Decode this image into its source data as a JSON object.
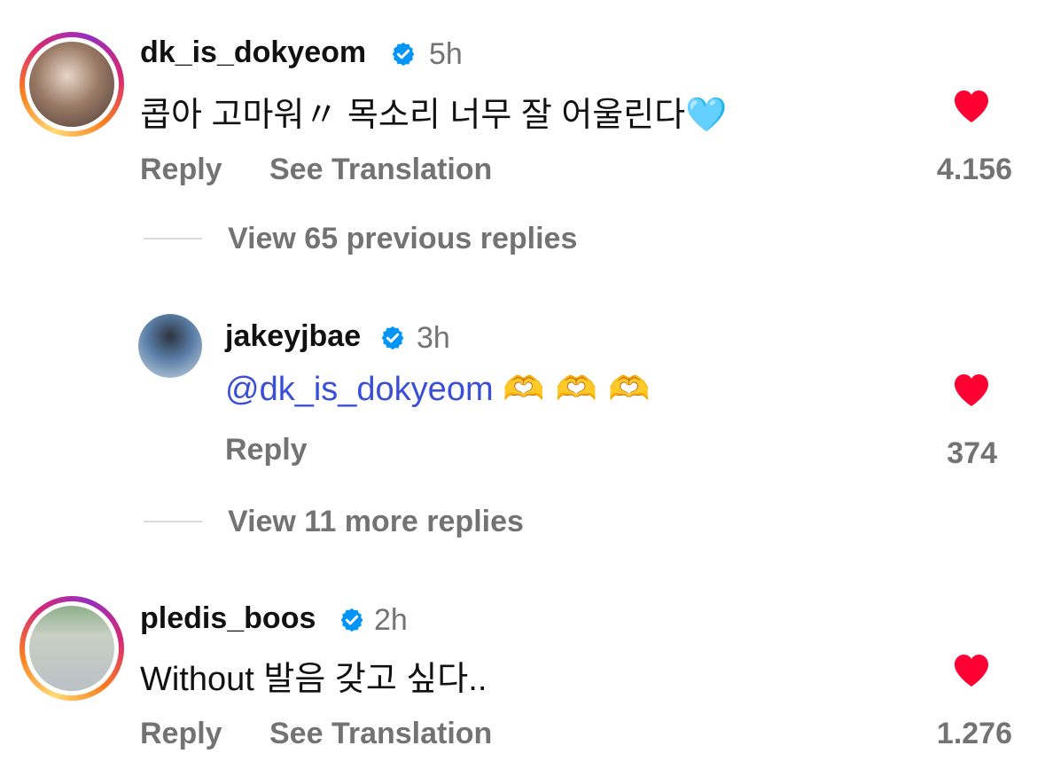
{
  "comments": [
    {
      "username": "dk_is_dokyeom",
      "time": "5h",
      "text": "콥아 고마워〃 목소리 너무 잘 어울린다",
      "emoji": "🩵",
      "reply_label": "Reply",
      "translate_label": "See Translation",
      "likes": "4.156"
    }
  ],
  "thread1_view": "View 65 previous replies",
  "reply": {
    "username": "jakeyjbae",
    "time": "3h",
    "mention": "@dk_is_dokyeom",
    "emoji": "🫶 🫶 🫶",
    "reply_label": "Reply",
    "likes": "374"
  },
  "thread2_view": "View 11 more replies",
  "comment2": {
    "username": "pledis_boos",
    "time": "2h",
    "text": "Without 발음 갖고 싶다..",
    "reply_label": "Reply",
    "translate_label": "See Translation",
    "likes": "1.276"
  },
  "colors": {
    "heart": "#ff0033",
    "verified": "#0095f6",
    "mention": "#3a4fd8",
    "secondary_text": "#737373"
  },
  "icons": [
    "verified-badge-icon",
    "heart-icon"
  ]
}
